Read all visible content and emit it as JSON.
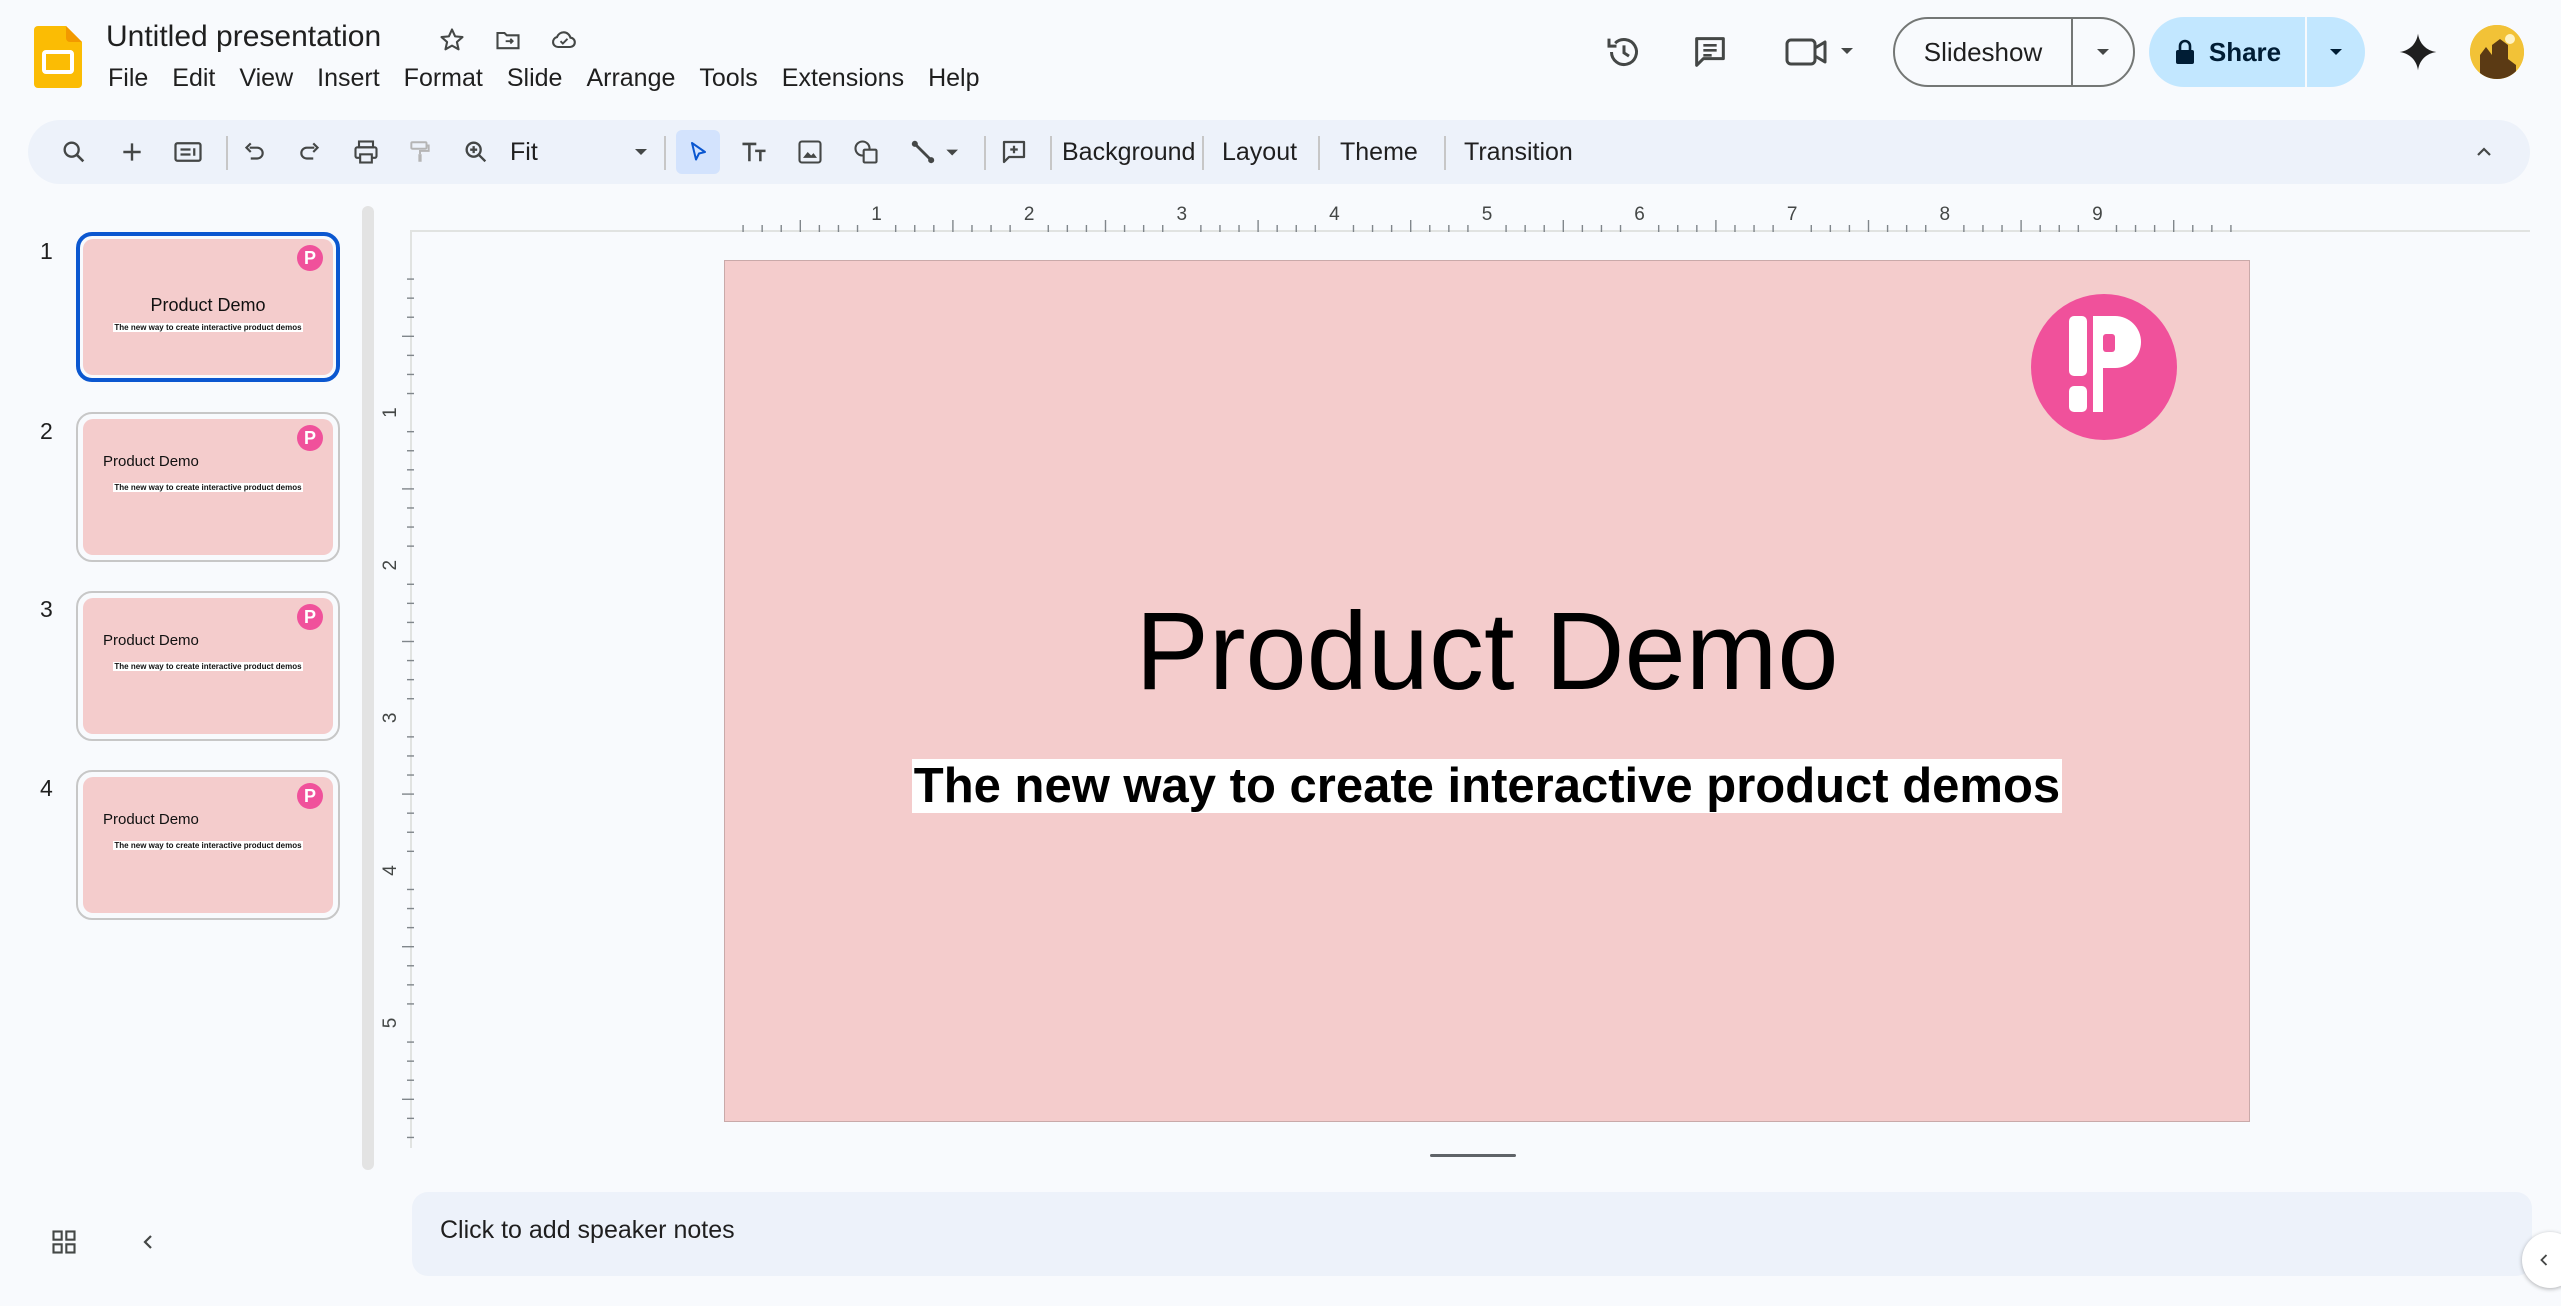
{
  "app": {
    "doc_title": "Untitled presentation",
    "menu": [
      "File",
      "Edit",
      "View",
      "Insert",
      "Format",
      "Slide",
      "Arrange",
      "Tools",
      "Extensions",
      "Help"
    ],
    "slideshow_label": "Slideshow",
    "share_label": "Share"
  },
  "toolbar": {
    "zoom_value": "Fit",
    "background_label": "Background",
    "layout_label": "Layout",
    "theme_label": "Theme",
    "transition_label": "Transition"
  },
  "filmstrip": {
    "slides": [
      {
        "number": "1",
        "title": "Product Demo",
        "subtitle": "The new way to create interactive product demos",
        "logo_letter": "P"
      },
      {
        "number": "2",
        "title": "Product Demo",
        "subtitle": "The new way to create interactive product demos",
        "logo_letter": "P"
      },
      {
        "number": "3",
        "title": "Product Demo",
        "subtitle": "The new way to create interactive product demos",
        "logo_letter": "P"
      },
      {
        "number": "4",
        "title": "Product Demo",
        "subtitle": "The new way to create interactive product demos",
        "logo_letter": "P"
      }
    ],
    "selected_index": 0
  },
  "rulers": {
    "horizontal_labels": [
      "1",
      "2",
      "3",
      "4",
      "5",
      "6",
      "7",
      "8",
      "9"
    ],
    "vertical_labels": [
      "1",
      "2",
      "3",
      "4",
      "5"
    ]
  },
  "slide": {
    "title": "Product Demo",
    "subtitle": "The new way to create interactive product demos",
    "background_color": "#f4cccc",
    "logo_color": "#f0519b"
  },
  "notes": {
    "placeholder": "Click to add speaker notes"
  },
  "colors": {
    "accent": "#0b57d0",
    "share_bg": "#c2e7ff",
    "toolbar_bg": "#edf2fa",
    "app_logo": "#fbbc04"
  }
}
